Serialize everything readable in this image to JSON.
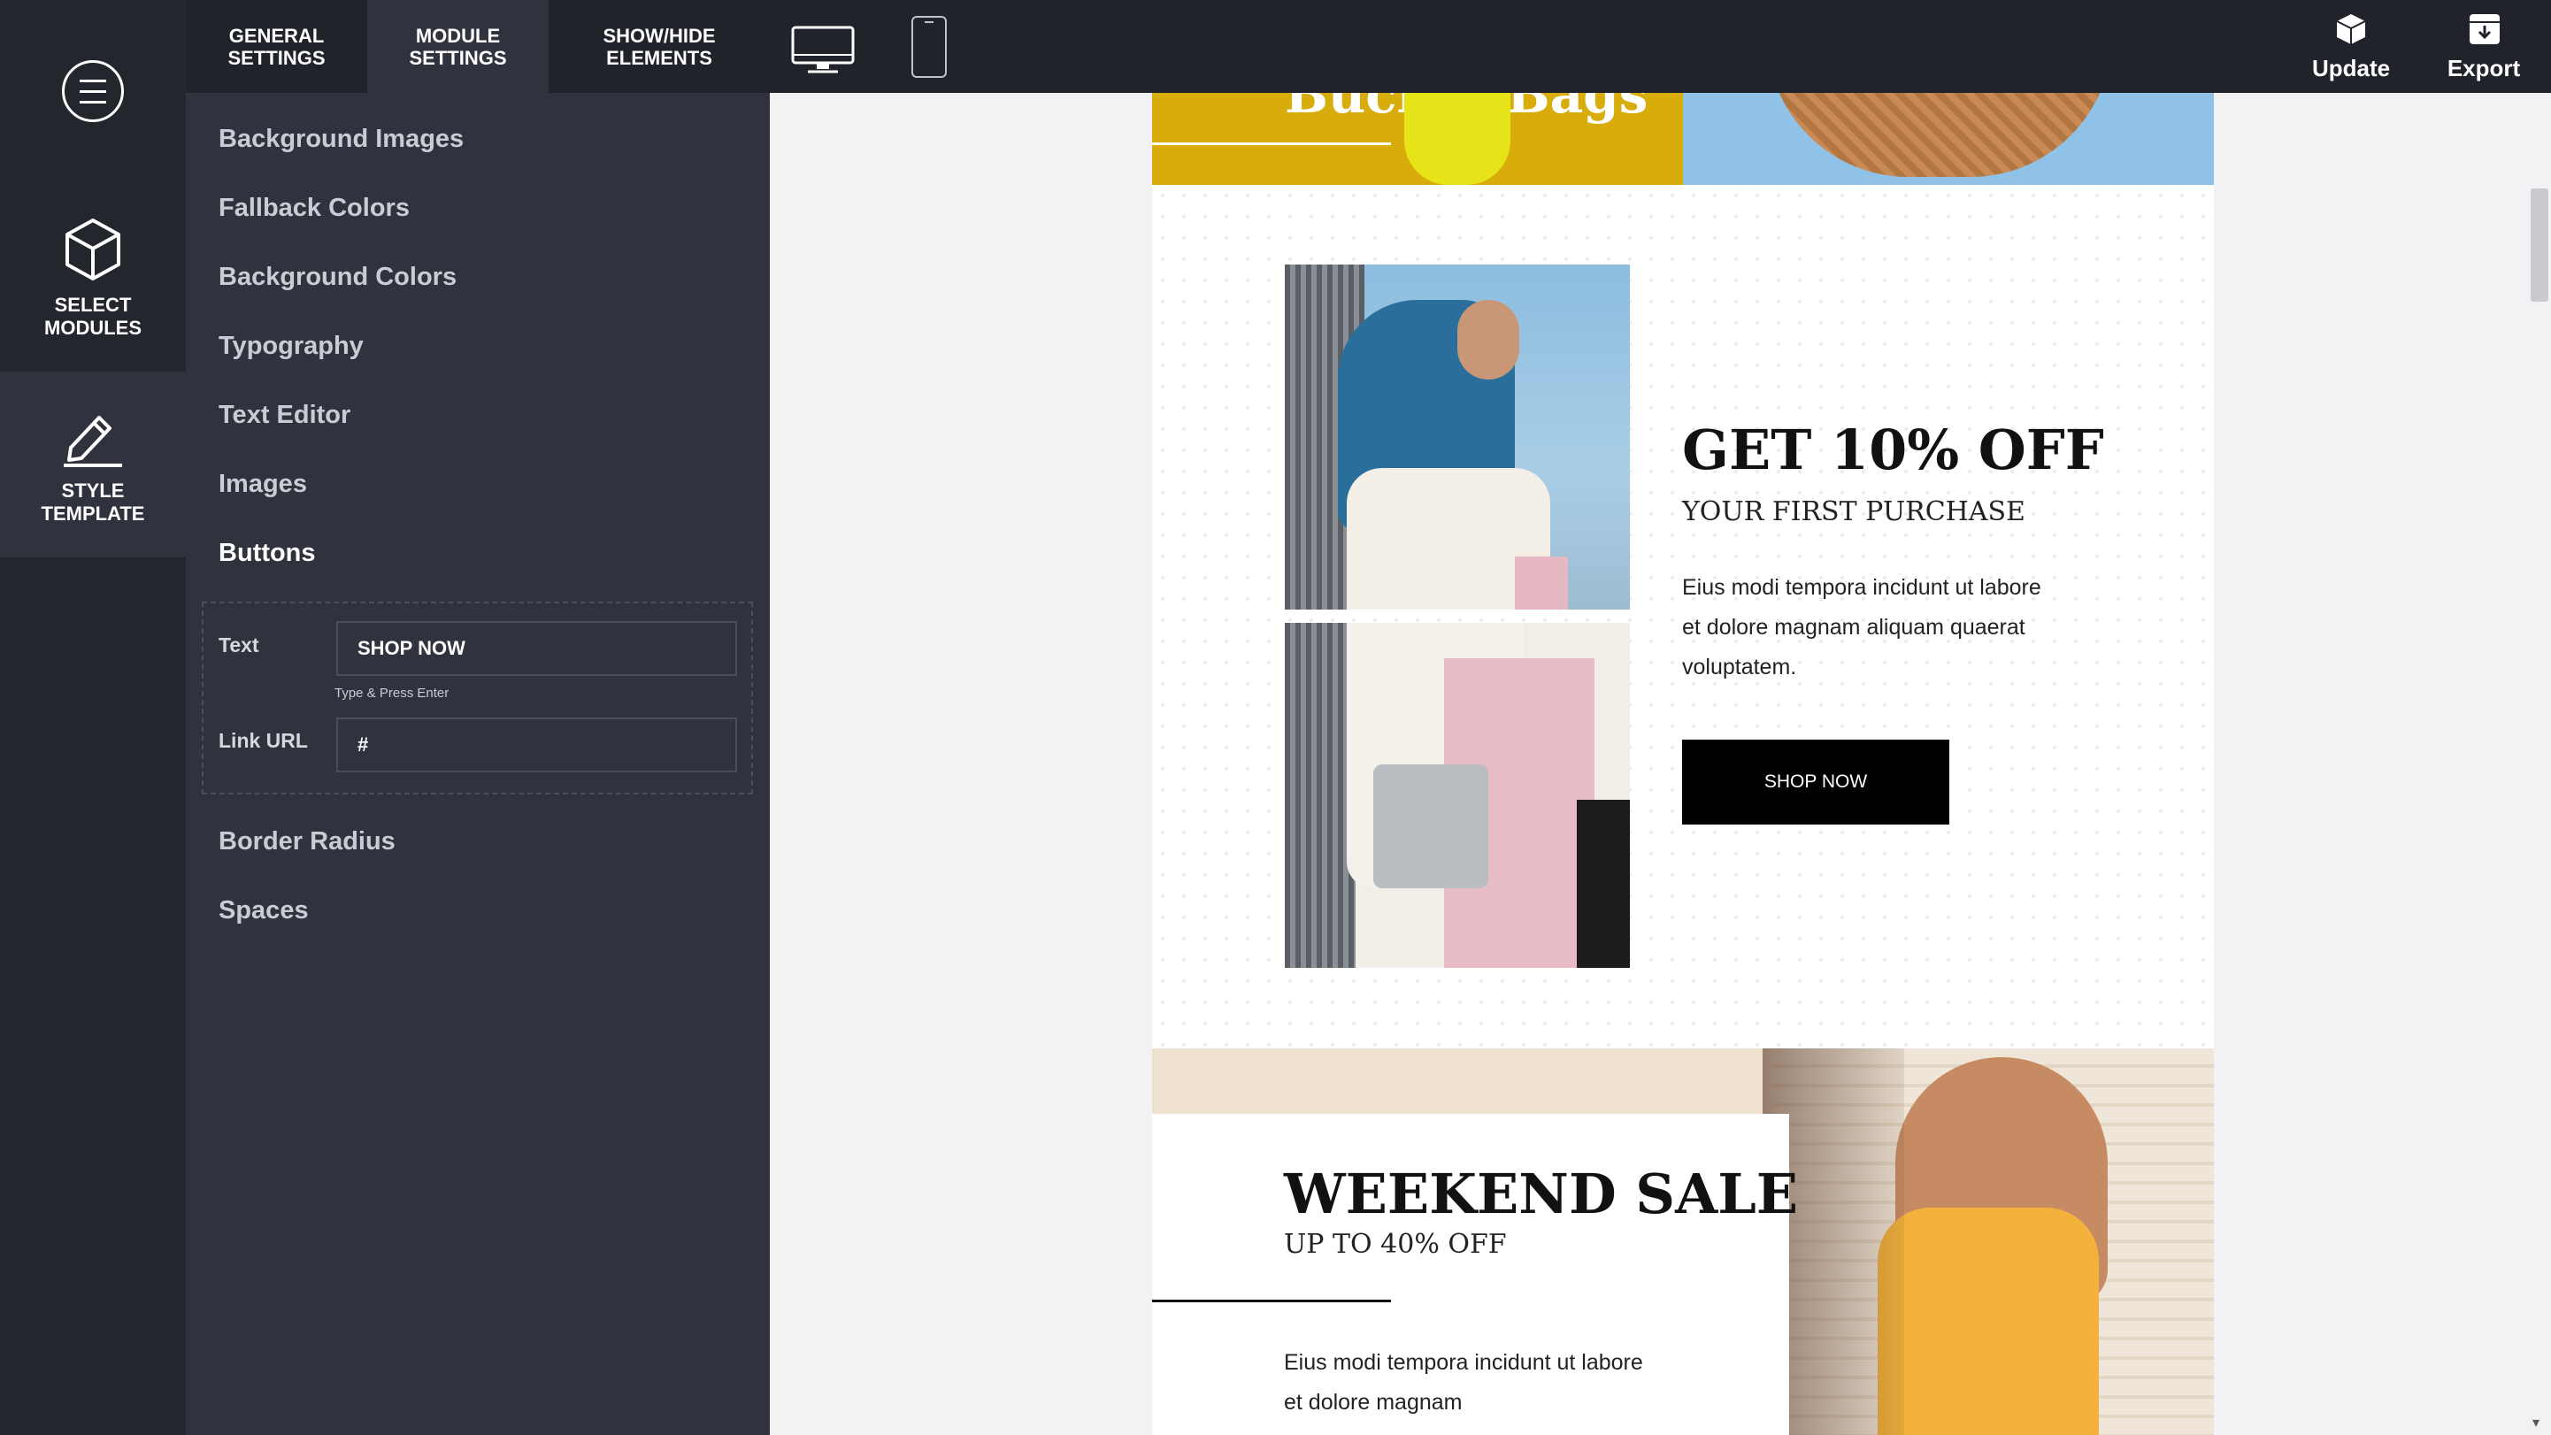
{
  "top_tabs": [
    {
      "label_line1": "GENERAL",
      "label_line2": "SETTINGS"
    },
    {
      "label_line1": "MODULE",
      "label_line2": "SETTINGS"
    },
    {
      "label_line1": "SHOW/HIDE",
      "label_line2": "ELEMENTS"
    }
  ],
  "actions": {
    "update": "Update",
    "export": "Export"
  },
  "rail": [
    {
      "label_line1": "SELECT",
      "label_line2": "MODULES",
      "icon": "cube-icon"
    },
    {
      "label_line1": "STYLE",
      "label_line2": "TEMPLATE",
      "icon": "pencil-icon"
    }
  ],
  "menu": {
    "items": [
      "Background Images",
      "Fallback Colors",
      "Background Colors",
      "Typography",
      "Text Editor",
      "Images",
      "Buttons",
      "Border Radius",
      "Spaces"
    ]
  },
  "buttons_panel": {
    "text_label": "Text",
    "text_value": "SHOP NOW",
    "hint": "Type & Press Enter",
    "link_label": "Link URL",
    "link_value": "#"
  },
  "preview": {
    "hero_title": "Bucket Bags",
    "promo": {
      "title": "GET 10% OFF",
      "subtitle": "YOUR FIRST PURCHASE",
      "body": "Eius modi tempora incidunt ut labore et dolore magnam aliquam quaerat voluptatem.",
      "button": "SHOP NOW"
    },
    "sale": {
      "title": "WEEKEND SALE",
      "subtitle": "UP TO 40% OFF",
      "body": "Eius modi tempora incidunt ut labore et dolore magnam"
    }
  },
  "colors": {
    "accent_dark": "#20232a",
    "panel": "#30333d",
    "hero_yellow": "#d7ac0b",
    "hero_blue": "#8fc2e6"
  }
}
